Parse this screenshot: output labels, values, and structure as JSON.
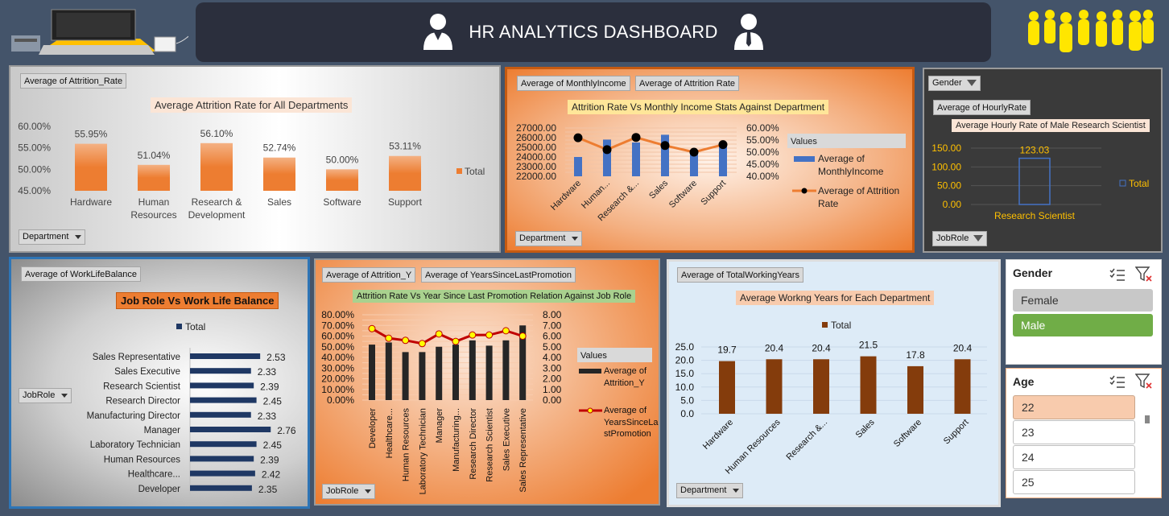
{
  "header": {
    "title": "HR ANALYTICS DASHBOARD"
  },
  "panel1": {
    "field_button": "Average of Attrition_Rate",
    "filter_button": "Department"
  },
  "panel2": {
    "field_button1": "Average of MonthlyIncome",
    "field_button2": "Average of Attrition Rate",
    "filter_button": "Department",
    "legend_title": "Values",
    "legend_items": [
      "Average of MonthlyIncome",
      "Average of Attrition Rate"
    ]
  },
  "panel3": {
    "filter_button": "Gender",
    "field_button": "Average of HourlyRate",
    "row_button": "JobRole",
    "legend": "Total"
  },
  "panel4": {
    "field_button": "Average of WorkLifeBalance",
    "filter_button": "JobRole",
    "legend": "Total"
  },
  "panel5": {
    "field_button1": "Average of Attrition_Y",
    "field_button2": "Average of YearsSinceLastPromotion",
    "filter_button": "JobRole",
    "legend_title": "Values",
    "legend_items": [
      "Average of Attrition_Y",
      "Average of YearsSinceLastPromotion"
    ]
  },
  "panel6": {
    "field_button": "Average of TotalWorkingYears",
    "filter_button": "Department",
    "legend": "Total"
  },
  "slicer_gender": {
    "title": "Gender",
    "items": [
      "Female",
      "Male"
    ],
    "selected": "Male"
  },
  "slicer_age": {
    "title": "Age",
    "items": [
      "22",
      "23",
      "24",
      "25"
    ],
    "selected": "22"
  },
  "colors": {
    "bg": "#44546a",
    "orange": "#ed7d31",
    "blue": "#4472c4",
    "navy": "#1f3864",
    "red": "#c00000",
    "brown": "#843c0c",
    "green": "#70ad47"
  },
  "chart_data": [
    {
      "id": "attrition_dept",
      "type": "bar",
      "title": "Average Attrition Rate for All Departments",
      "categories": [
        "Hardware",
        "Human Resources",
        "Research & Development",
        "Sales",
        "Software",
        "Support"
      ],
      "values": [
        55.95,
        51.04,
        56.1,
        52.74,
        50.0,
        53.11
      ],
      "value_labels": [
        "55.95%",
        "51.04%",
        "56.10%",
        "52.74%",
        "50.00%",
        "53.11%"
      ],
      "ylim": [
        45,
        60
      ],
      "yticks": [
        "60.00%",
        "55.00%",
        "50.00%",
        "45.00%"
      ],
      "legend": "Total"
    },
    {
      "id": "income_attrition",
      "type": "bar",
      "title": "Attrition Rate Vs Monthly Income Stats Against Department",
      "categories": [
        "Hardware",
        "Human...",
        "Research &...",
        "Sales",
        "Software",
        "Support"
      ],
      "series": [
        {
          "name": "Average of MonthlyIncome",
          "type": "bar",
          "values": [
            24000,
            25800,
            25500,
            26300,
            24600,
            25100
          ]
        },
        {
          "name": "Average of Attrition Rate",
          "type": "line",
          "values": [
            55.95,
            51.04,
            56.1,
            52.74,
            50.0,
            53.11
          ]
        }
      ],
      "y_left": {
        "ylim": [
          22000,
          27000
        ],
        "ticks": [
          "27000.00",
          "26000.00",
          "25000.00",
          "24000.00",
          "23000.00",
          "22000.00"
        ]
      },
      "y_right": {
        "ylim": [
          40,
          60
        ],
        "ticks": [
          "60.00%",
          "55.00%",
          "50.00%",
          "45.00%",
          "40.00%"
        ]
      }
    },
    {
      "id": "hourly_rate",
      "type": "bar",
      "title": "Average Hourly Rate of Male Research Scientist",
      "categories": [
        "Research Scientist"
      ],
      "values": [
        123.03
      ],
      "value_labels": [
        "123.03"
      ],
      "ylim": [
        0,
        150
      ],
      "yticks": [
        "150.00",
        "100.00",
        "50.00",
        "0.00"
      ],
      "legend": "Total"
    },
    {
      "id": "worklife",
      "type": "bar",
      "orientation": "horizontal",
      "title": "Job Role Vs Work Life Balance",
      "categories": [
        "Sales Representative",
        "Sales Executive",
        "Research Scientist",
        "Research Director",
        "Manufacturing Director",
        "Manager",
        "Laboratory Technician",
        "Human Resources",
        "Healthcare...",
        "Developer"
      ],
      "values": [
        2.53,
        2.33,
        2.39,
        2.45,
        2.33,
        2.76,
        2.45,
        2.39,
        2.42,
        2.35
      ],
      "value_labels": [
        "2.53",
        "2.33",
        "2.39",
        "2.45",
        "2.33",
        "2.76",
        "2.45",
        "2.39",
        "2.42",
        "2.35"
      ],
      "xlim": [
        0,
        2.8
      ],
      "legend": "Total"
    },
    {
      "id": "attrition_promotion",
      "type": "bar",
      "title": "Attrition Rate Vs Year Since Last Promotion Relation Against Job Role",
      "categories": [
        "Developer",
        "Healthcare...",
        "Human Resources",
        "Laboratory Technician",
        "Manager",
        "Manufacturing...",
        "Research Director",
        "Research Scientist",
        "Sales Executive",
        "Sales Representative"
      ],
      "series": [
        {
          "name": "Average of Attrition_Y",
          "type": "bar",
          "values": [
            52,
            54,
            45,
            45,
            50,
            52,
            56,
            51,
            56,
            70
          ]
        },
        {
          "name": "Average of YearsSinceLastPromotion",
          "type": "line",
          "values": [
            6.7,
            5.8,
            5.6,
            5.3,
            6.2,
            5.5,
            6.1,
            6.1,
            6.5,
            6.0
          ]
        }
      ],
      "y_left": {
        "ylim": [
          0,
          80
        ],
        "ticks": [
          "80.00%",
          "70.00%",
          "60.00%",
          "50.00%",
          "40.00%",
          "30.00%",
          "20.00%",
          "10.00%",
          "0.00%"
        ]
      },
      "y_right": {
        "ylim": [
          0,
          8
        ],
        "ticks": [
          "8.00",
          "7.00",
          "6.00",
          "5.00",
          "4.00",
          "3.00",
          "2.00",
          "1.00",
          "0.00"
        ]
      }
    },
    {
      "id": "working_years",
      "type": "bar",
      "title": "Average Workng Years for Each Department",
      "categories": [
        "Hardware",
        "Human Resources",
        "Research &...",
        "Sales",
        "Software",
        "Support"
      ],
      "values": [
        19.7,
        20.4,
        20.4,
        21.5,
        17.8,
        20.4
      ],
      "value_labels": [
        "19.7",
        "20.4",
        "20.4",
        "21.5",
        "17.8",
        "20.4"
      ],
      "ylim": [
        0,
        25
      ],
      "yticks": [
        "25.0",
        "20.0",
        "15.0",
        "10.0",
        "5.0",
        "0.0"
      ],
      "legend": "Total"
    }
  ]
}
